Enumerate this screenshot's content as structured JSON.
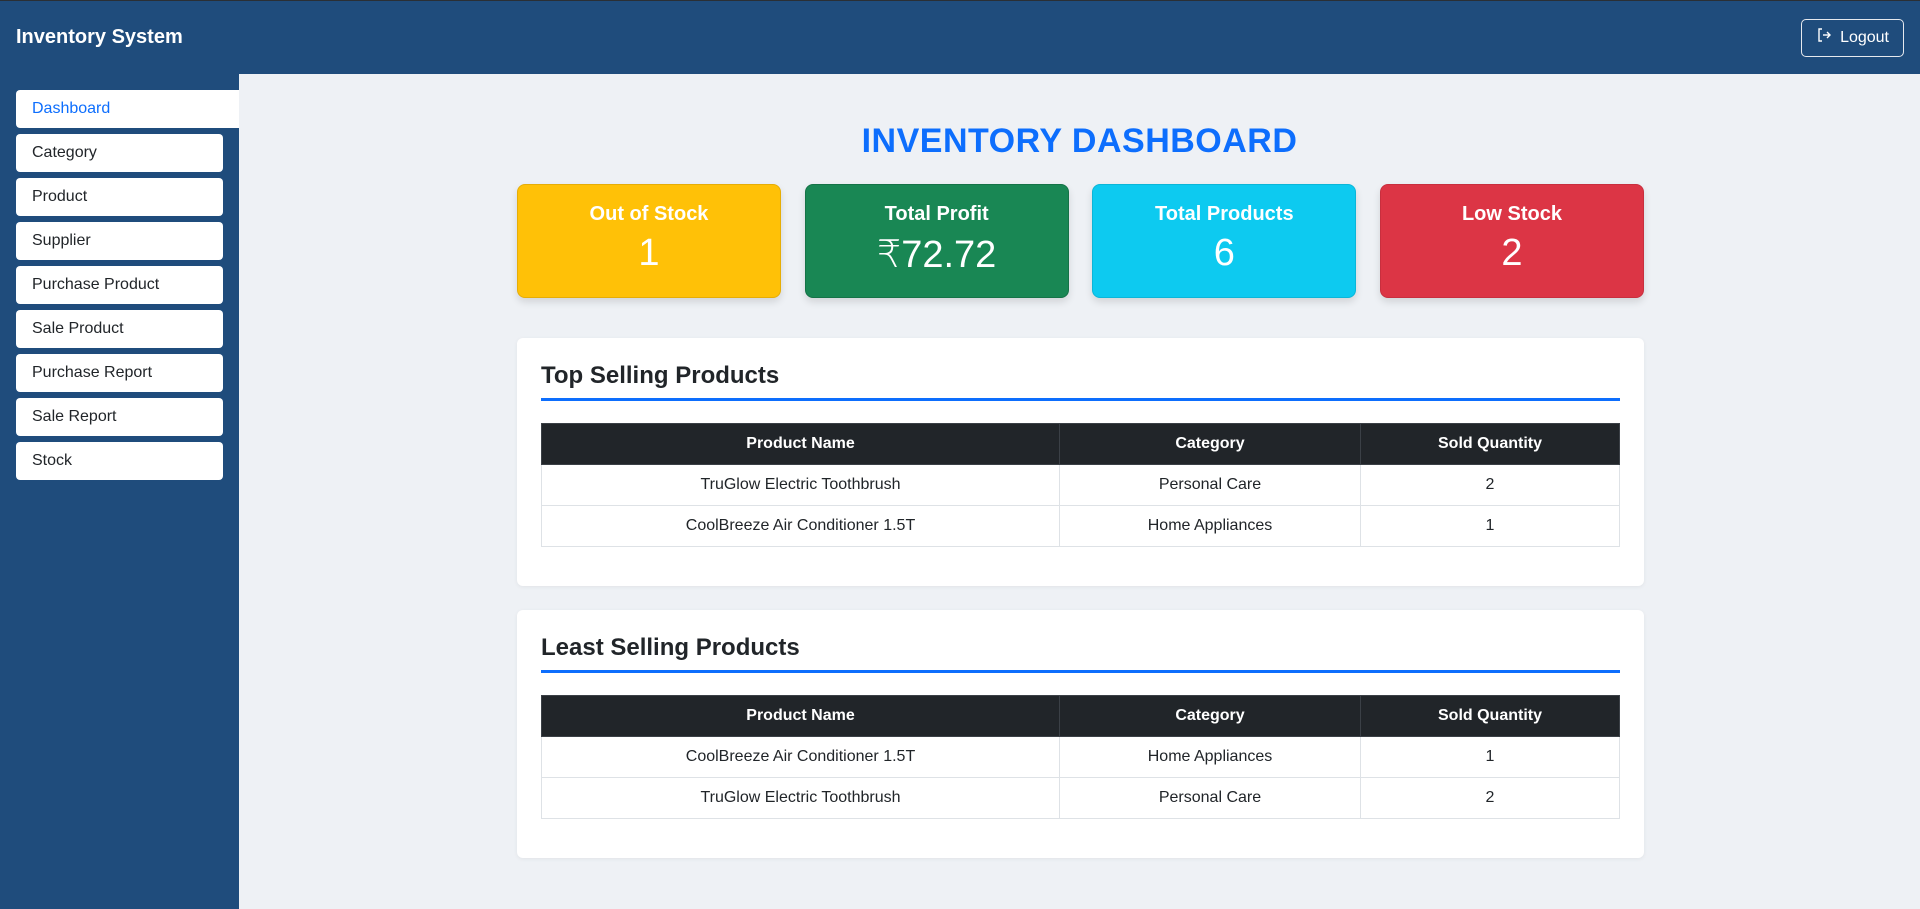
{
  "header": {
    "brand": "Inventory System",
    "logout_label": "Logout"
  },
  "sidebar": {
    "items": [
      {
        "label": "Dashboard",
        "active": true
      },
      {
        "label": "Category"
      },
      {
        "label": "Product"
      },
      {
        "label": "Supplier"
      },
      {
        "label": "Purchase Product"
      },
      {
        "label": "Sale Product"
      },
      {
        "label": "Purchase Report"
      },
      {
        "label": "Sale Report"
      },
      {
        "label": "Stock"
      }
    ]
  },
  "main": {
    "title": "INVENTORY DASHBOARD",
    "cards": [
      {
        "label": "Out of Stock",
        "value": "1",
        "color": "#ffc107"
      },
      {
        "label": "Total Profit",
        "value": "₹72.72",
        "color": "#198754"
      },
      {
        "label": "Total Products",
        "value": "6",
        "color": "#0dcaf0"
      },
      {
        "label": "Low Stock",
        "value": "2",
        "color": "#dc3545"
      }
    ],
    "top_selling": {
      "title": "Top Selling Products",
      "columns": [
        "Product Name",
        "Category",
        "Sold Quantity"
      ],
      "rows": [
        [
          "TruGlow Electric Toothbrush",
          "Personal Care",
          "2"
        ],
        [
          "CoolBreeze Air Conditioner 1.5T",
          "Home Appliances",
          "1"
        ]
      ]
    },
    "least_selling": {
      "title": "Least Selling Products",
      "columns": [
        "Product Name",
        "Category",
        "Sold Quantity"
      ],
      "rows": [
        [
          "CoolBreeze Air Conditioner 1.5T",
          "Home Appliances",
          "1"
        ],
        [
          "TruGlow Electric Toothbrush",
          "Personal Care",
          "2"
        ]
      ]
    }
  },
  "colors": {
    "nav_bg": "#1f4c7c",
    "accent": "#0d6efd",
    "table_header": "#212529",
    "page_bg": "#eef1f5"
  }
}
